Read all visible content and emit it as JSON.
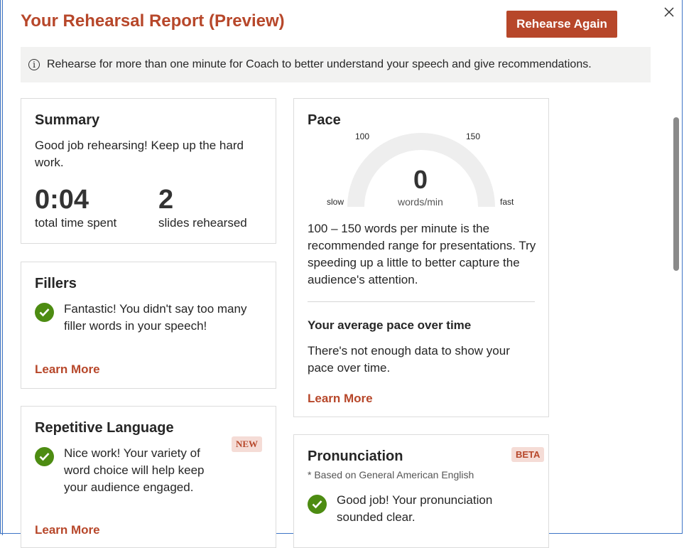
{
  "header": {
    "title": "Your Rehearsal Report (Preview)",
    "rehearse_again_label": "Rehearse Again"
  },
  "info_bar": {
    "message": "Rehearse for more than one minute for Coach to better understand your speech and give recommendations."
  },
  "summary": {
    "title": "Summary",
    "message": "Good job rehearsing! Keep up the hard work.",
    "time_value": "0:04",
    "time_label": "total time spent",
    "slides_value": "2",
    "slides_label": "slides rehearsed"
  },
  "fillers": {
    "title": "Fillers",
    "message": "Fantastic! You didn't say too many filler words in your speech!",
    "learn_more": "Learn More"
  },
  "repetitive": {
    "title": "Repetitive Language",
    "badge": "NEW",
    "message": "Nice work! Your variety of word choice will help keep your audience engaged.",
    "learn_more": "Learn More"
  },
  "pace": {
    "title": "Pace",
    "gauge": {
      "value": "0",
      "unit": "words/min",
      "tick_low": "100",
      "tick_high": "150",
      "label_slow": "slow",
      "label_fast": "fast"
    },
    "message": "100 – 150 words per minute is the recommended range for presentations. Try speeding up a little to better capture the audience's attention.",
    "over_time_title": "Your average pace over time",
    "over_time_message": "There's not enough data to show your pace over time.",
    "learn_more": "Learn More"
  },
  "pronunciation": {
    "title": "Pronunciation",
    "badge": "BETA",
    "note": "* Based on General American English",
    "message": "Good job! Your pronunciation sounded clear."
  },
  "colors": {
    "accent": "#b7472a",
    "success": "#4d8c12",
    "info_bg": "#f2f2f1",
    "gauge": "#eeeeee"
  }
}
